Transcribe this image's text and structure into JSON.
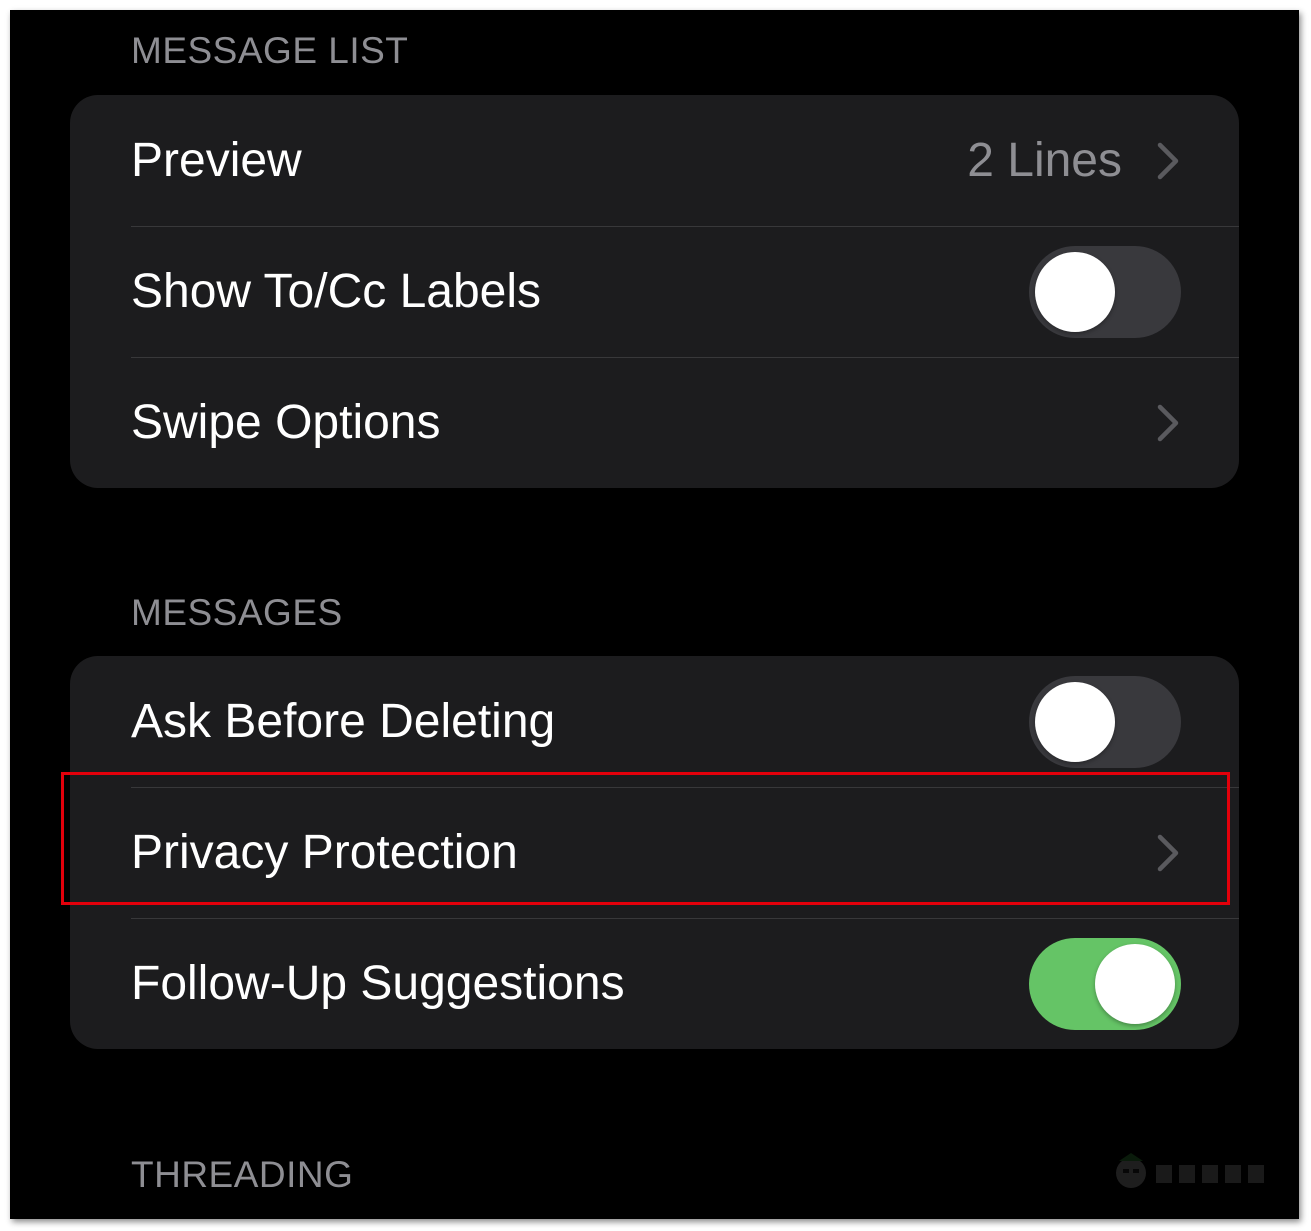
{
  "sections": [
    {
      "header": "MESSAGE LIST",
      "rows": [
        {
          "label": "Preview",
          "value": "2 Lines",
          "accessory": "chevron-right-icon"
        },
        {
          "label": "Show To/Cc Labels",
          "toggle": false
        },
        {
          "label": "Swipe Options",
          "accessory": "chevron-right-icon"
        }
      ]
    },
    {
      "header": "MESSAGES",
      "rows": [
        {
          "label": "Ask Before Deleting",
          "toggle": false
        },
        {
          "label": "Privacy Protection",
          "accessory": "chevron-right-icon",
          "highlighted": true
        },
        {
          "label": "Follow-Up Suggestions",
          "toggle": true
        }
      ]
    },
    {
      "header": "THREADING",
      "rows": []
    }
  ],
  "colors": {
    "background": "#000000",
    "group_background": "#1c1c1e",
    "label_text": "#ffffff",
    "secondary_text": "#8e8e93",
    "toggle_on": "#65c466",
    "toggle_off": "#39393d",
    "highlight_border": "#e3000b"
  },
  "watermark": {
    "icon": "appuals-mascot-logo"
  }
}
